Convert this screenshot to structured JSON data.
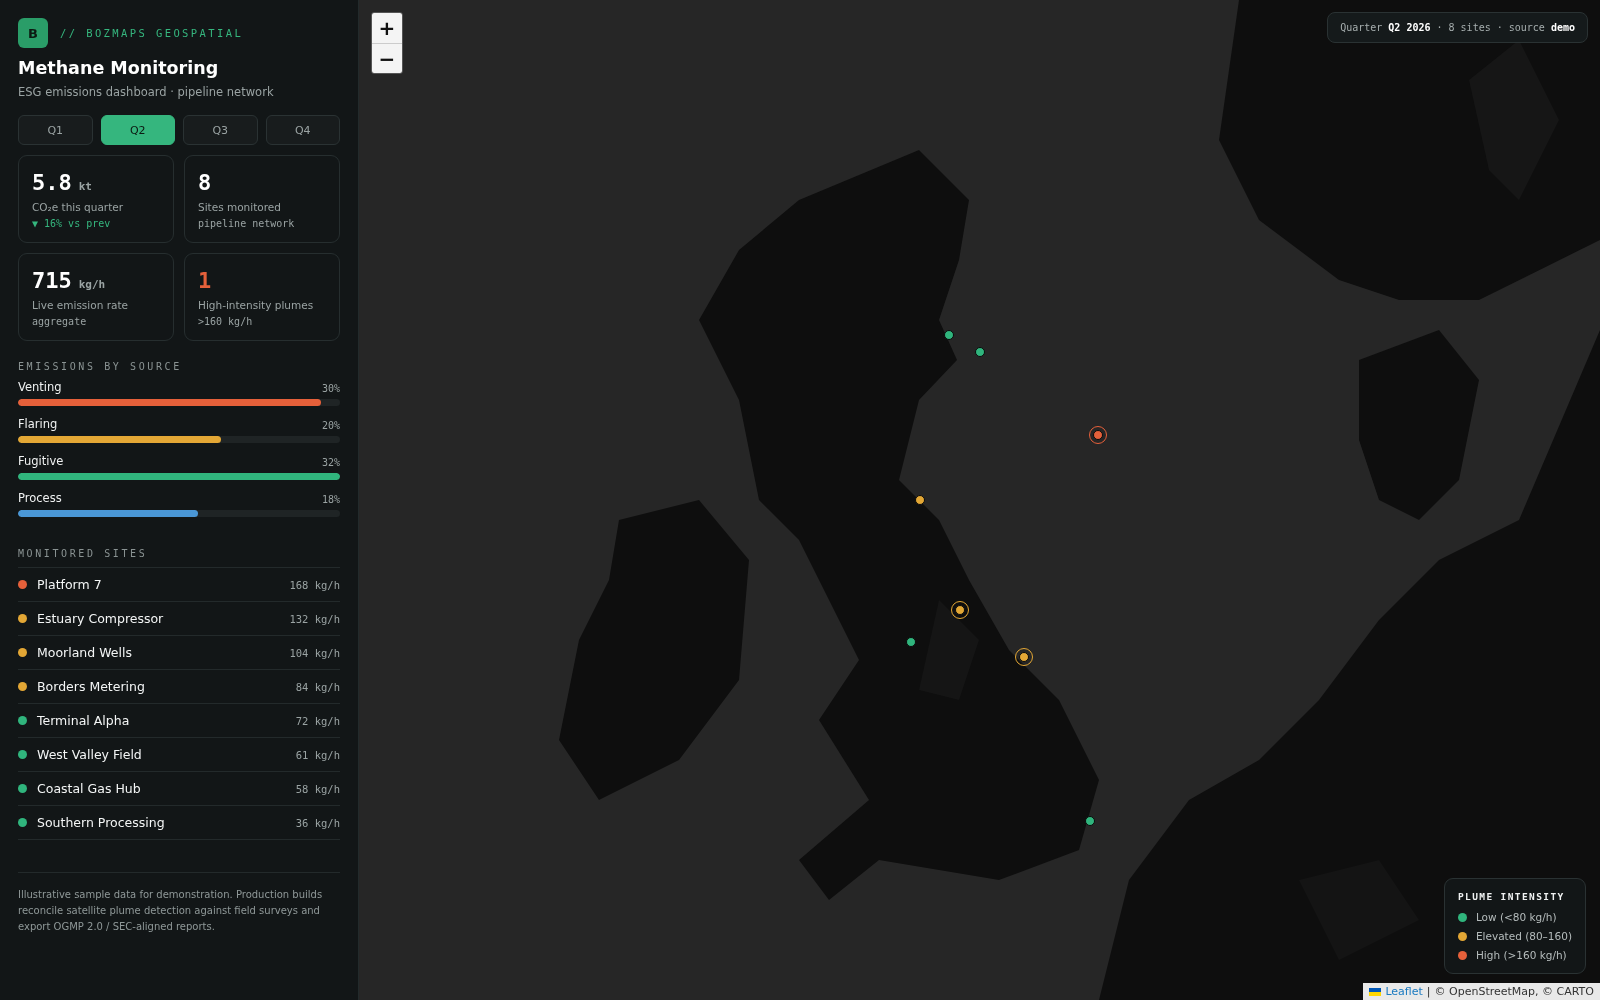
{
  "brand": {
    "logo": "B",
    "tagline": "// BOZMAPS GEOSPATIAL"
  },
  "title": "Methane Monitoring",
  "subtitle": "ESG emissions dashboard · pipeline network",
  "quarters": [
    {
      "label": "Q1",
      "selected": false
    },
    {
      "label": "Q2",
      "selected": true
    },
    {
      "label": "Q3",
      "selected": false
    },
    {
      "label": "Q4",
      "selected": false
    }
  ],
  "stats": [
    {
      "value": "5.8",
      "unit": "kt",
      "label": "CO₂e this quarter",
      "note": "▼ 16% vs prev",
      "note_positive": true,
      "alert": false
    },
    {
      "value": "8",
      "label": "Sites monitored",
      "note": "pipeline network",
      "note_positive": false,
      "alert": false
    },
    {
      "value": "715",
      "unit": "kg/h",
      "label": "Live emission rate",
      "note": "aggregate",
      "note_positive": false,
      "alert": false
    },
    {
      "value": "1",
      "label": "High-intensity plumes",
      "note": ">160 kg/h",
      "note_positive": false,
      "alert": true
    }
  ],
  "sources_heading": "EMISSIONS BY SOURCE",
  "sources": [
    {
      "name": "Venting",
      "percent": "30%",
      "level": 0.94,
      "color": "#e5603a"
    },
    {
      "name": "Flaring",
      "percent": "20%",
      "level": 0.63,
      "color": "#e3a735"
    },
    {
      "name": "Fugitive",
      "percent": "32%",
      "level": 1.0,
      "color": "#30b57d"
    },
    {
      "name": "Process",
      "percent": "18%",
      "level": 0.56,
      "color": "#4a97d6"
    }
  ],
  "sites_heading": "MONITORED SITES",
  "sites": [
    {
      "name": "Platform 7",
      "rate": "168 kg/h",
      "color": "#e5603a"
    },
    {
      "name": "Estuary Compressor",
      "rate": "132 kg/h",
      "color": "#e3a735"
    },
    {
      "name": "Moorland Wells",
      "rate": "104 kg/h",
      "color": "#e3a735"
    },
    {
      "name": "Borders Metering",
      "rate": "84 kg/h",
      "color": "#e3a735"
    },
    {
      "name": "Terminal Alpha",
      "rate": "72 kg/h",
      "color": "#30b57d"
    },
    {
      "name": "West Valley Field",
      "rate": "61 kg/h",
      "color": "#30b57d"
    },
    {
      "name": "Coastal Gas Hub",
      "rate": "58 kg/h",
      "color": "#30b57d"
    },
    {
      "name": "Southern Processing",
      "rate": "36 kg/h",
      "color": "#30b57d"
    }
  ],
  "footnote": "Illustrative sample data for demonstration. Production builds reconcile satellite plume detection against field surveys and export OGMP 2.0 / SEC-aligned reports.",
  "map": {
    "zoom_in": "+",
    "zoom_out": "−",
    "info": "Quarter **Q2 2026** · 8 sites · source **demo**",
    "markers": [
      {
        "color": "#30b57d",
        "ringed": false
      },
      {
        "color": "#30b57d",
        "ringed": false
      },
      {
        "color": "#e5603a",
        "ringed": true
      },
      {
        "color": "#e3a735",
        "ringed": false
      },
      {
        "color": "#e3a735",
        "ringed": true
      },
      {
        "color": "#30b57d",
        "ringed": false
      },
      {
        "color": "#e3a735",
        "ringed": true
      },
      {
        "color": "#30b57d",
        "ringed": false
      }
    ],
    "legend": {
      "title": "PLUME INTENSITY",
      "items": [
        {
          "label": "Low (<80 kg/h)",
          "color": "#30b57d"
        },
        {
          "label": "Elevated (80–160)",
          "color": "#e3a735"
        },
        {
          "label": "High (>160 kg/h)",
          "color": "#e5603a"
        }
      ]
    },
    "attribution": {
      "link": "Leaflet",
      "separator": "|",
      "credits": "© OpenStreetMap, © CARTO"
    }
  }
}
